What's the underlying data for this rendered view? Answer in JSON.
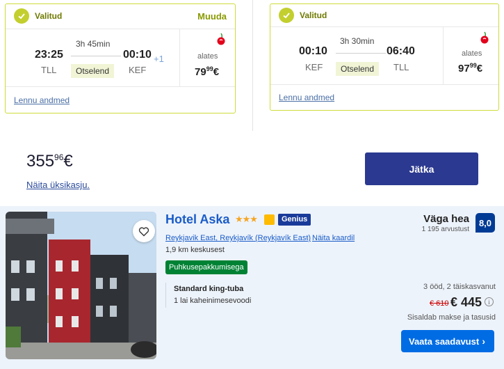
{
  "flights": [
    {
      "status": "Valitud",
      "change_label": "Muuda",
      "depart_time": "23:25",
      "depart_code": "TLL",
      "duration": "3h 45min",
      "type": "Otselend",
      "arrive_time": "00:10",
      "arrive_code": "KEF",
      "plus_day": "+1",
      "from_label": "alates",
      "price_main": "79",
      "price_cents": "99",
      "currency": "€",
      "details_link": "Lennu andmed"
    },
    {
      "status": "Valitud",
      "depart_time": "00:10",
      "depart_code": "KEF",
      "duration": "3h 30min",
      "type": "Otselend",
      "arrive_time": "06:40",
      "arrive_code": "TLL",
      "from_label": "alates",
      "price_main": "97",
      "price_cents": "99",
      "currency": "€",
      "details_link": "Lennu andmed"
    }
  ],
  "total": {
    "price_main": "355",
    "price_cents": "96",
    "currency": "€",
    "single_price_link": "Näita üksikasju.",
    "continue_button": "Jätka"
  },
  "hotel": {
    "name": "Hotel Aska",
    "stars": "★★★",
    "genius_badge": "Genius",
    "location_link": "Reykjavik East, Reykjavík (Reykjavík East)",
    "map_link": "Näita kaardil",
    "distance": "1,9 km keskusest",
    "promo_badge": "Puhkusepakkumisega",
    "room_name": "Standard king-tuba",
    "bed_info": "1 lai kaheinimesevoodi",
    "rating_word": "Väga hea",
    "reviews": "1 195 arvustust",
    "score": "8,0",
    "stay_info": "3 ööd, 2 täiskasvanut",
    "old_price": "€ 610",
    "new_price": "€ 445",
    "taxes_note": "Sisaldab makse ja tasusid",
    "availability_button": "Vaata saadavust"
  },
  "icons": {
    "check": "check-icon",
    "cherry": "cherry-logo-icon",
    "heart": "heart-icon",
    "info": "info-icon",
    "chevron": "chevron-right-icon"
  },
  "colors": {
    "accent_lime": "#c3cf2e",
    "continue_button": "#2b3990",
    "hotel_link": "#1a5cc8",
    "score_badge": "#003b95",
    "promo_green": "#008234",
    "avail_button": "#006ce4"
  }
}
